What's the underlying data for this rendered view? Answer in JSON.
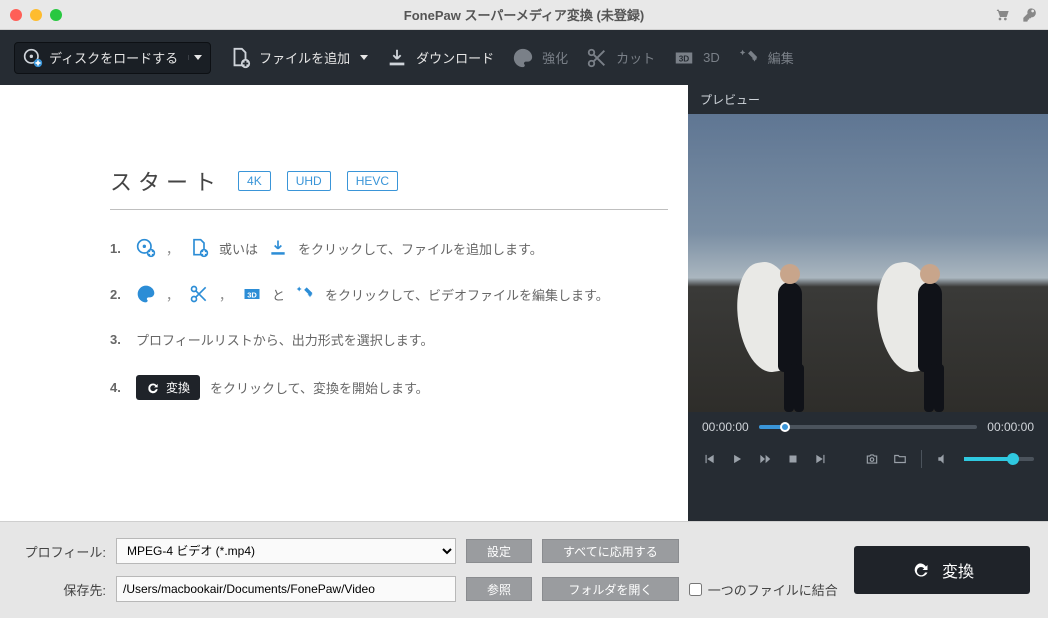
{
  "title": "FonePaw スーパーメディア変換 (未登録)",
  "toolbar": {
    "load_disk": "ディスクをロードする",
    "add_file": "ファイルを追加",
    "download": "ダウンロード",
    "enhance": "強化",
    "cut": "カット",
    "three_d": "3D",
    "edit": "編集"
  },
  "start": {
    "heading": "スタート",
    "badges": [
      "4K",
      "UHD",
      "HEVC"
    ],
    "steps": {
      "s1_mid": "或いは",
      "s1_tail": "をクリックして、ファイルを追加します。",
      "s2_mid": "と",
      "s2_tail": "をクリックして、ビデオファイルを編集します。",
      "s3": "プロフィールリストから、出力形式を選択します。",
      "s4_btn": "変換",
      "s4_tail": "をクリックして、変換を開始します。"
    }
  },
  "preview": {
    "title": "プレビュー",
    "time_current": "00:00:00",
    "time_total": "00:00:00"
  },
  "bottom": {
    "profile_label": "プロフィール:",
    "profile_value": "MPEG-4 ビデオ (*.mp4)",
    "settings_btn": "設定",
    "apply_all_btn": "すべてに応用する",
    "dest_label": "保存先:",
    "dest_value": "/Users/macbookair/Documents/FonePaw/Video",
    "browse_btn": "参照",
    "open_folder_btn": "フォルダを開く",
    "merge_label": "一つのファイルに結合",
    "convert_btn": "変換"
  }
}
